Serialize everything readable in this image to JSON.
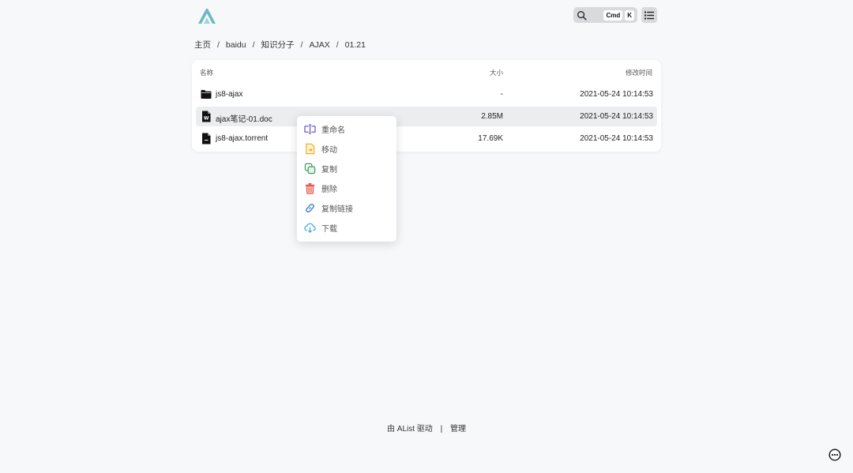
{
  "header": {
    "search_kbd": [
      "Cmd",
      "K"
    ]
  },
  "breadcrumb": [
    "主页",
    "baidu",
    "知识分子",
    "AJAX",
    "01.21"
  ],
  "breadcrumb_separator": "/",
  "table": {
    "headers": {
      "name": "名称",
      "size": "大小",
      "modified": "修改时间"
    },
    "rows": [
      {
        "name": "js8-ajax",
        "size": "-",
        "modified": "2021-05-24 10:14:53",
        "icon": "folder-icon"
      },
      {
        "name": "ajax笔记-01.doc",
        "size": "2.85M",
        "modified": "2021-05-24 10:14:53",
        "icon": "word-file-icon"
      },
      {
        "name": "js8-ajax.torrent",
        "size": "17.69K",
        "modified": "2021-05-24 10:14:53",
        "icon": "file-icon"
      }
    ]
  },
  "context_menu": {
    "items": [
      {
        "label": "重命名",
        "icon": "rename-icon",
        "color": "#6b5bd6"
      },
      {
        "label": "移动",
        "icon": "move-icon",
        "color": "#f2b01e"
      },
      {
        "label": "复制",
        "icon": "copy-icon",
        "color": "#3c9a5f"
      },
      {
        "label": "删除",
        "icon": "delete-icon",
        "color": "#e5534b"
      },
      {
        "label": "复制链接",
        "icon": "link-icon",
        "color": "#3b7fd0"
      },
      {
        "label": "下载",
        "icon": "download-icon",
        "color": "#3fa9d8"
      }
    ]
  },
  "footer": {
    "powered_by": "由 AList 驱动",
    "separator": "|",
    "manage": "管理"
  },
  "colors": {
    "background": "#f7f8fa",
    "logo": "#6fb8c2",
    "hover_row": "#ebedef"
  }
}
